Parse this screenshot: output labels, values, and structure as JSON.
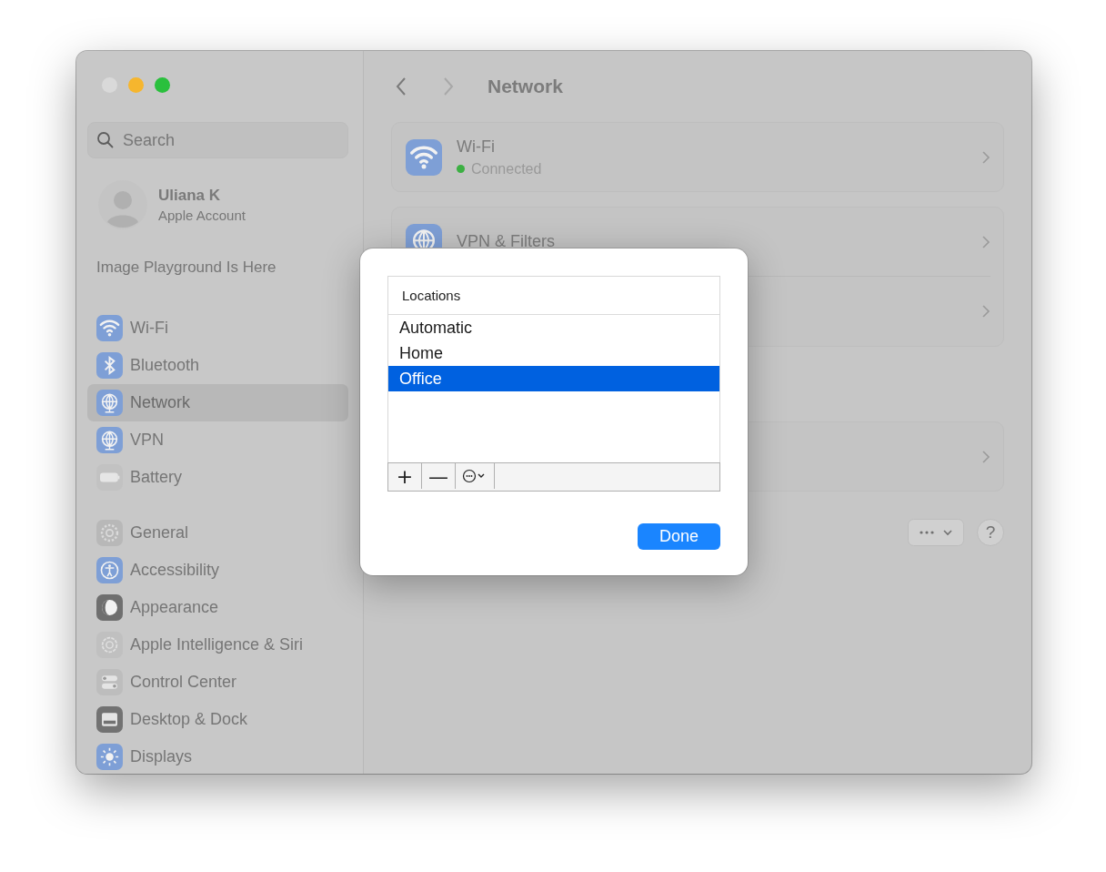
{
  "sidebar": {
    "search": {
      "placeholder": "Search"
    },
    "account": {
      "name": "Uliana K",
      "subtitle": "Apple Account"
    },
    "promo": "Image Playground Is Here",
    "groups": [
      [
        {
          "label": "Wi-Fi",
          "selected": false
        },
        {
          "label": "Bluetooth",
          "selected": false
        },
        {
          "label": "Network",
          "selected": true
        },
        {
          "label": "VPN",
          "selected": false
        },
        {
          "label": "Battery",
          "selected": false
        }
      ],
      [
        {
          "label": "General",
          "selected": false
        },
        {
          "label": "Accessibility",
          "selected": false
        },
        {
          "label": "Appearance",
          "selected": false
        },
        {
          "label": "Apple Intelligence & Siri",
          "selected": false
        },
        {
          "label": "Control Center",
          "selected": false
        },
        {
          "label": "Desktop & Dock",
          "selected": false
        },
        {
          "label": "Displays",
          "selected": false
        }
      ]
    ]
  },
  "main": {
    "title": "Network",
    "cards": [
      {
        "rows": [
          {
            "kind": "item",
            "title": "Wi-Fi",
            "status": "Connected"
          }
        ]
      },
      {
        "rows": [
          {
            "kind": "item",
            "title": "VPN & Filters"
          },
          {
            "kind": "blank"
          }
        ]
      },
      {
        "rows": [
          {
            "kind": "blank"
          }
        ]
      }
    ],
    "help": "?"
  },
  "dialog": {
    "header": "Locations",
    "rows": [
      {
        "label": "Automatic",
        "selected": false
      },
      {
        "label": "Home",
        "selected": false
      },
      {
        "label": "Office",
        "selected": true
      }
    ],
    "toolbar": [
      "+",
      "—"
    ],
    "done": "Done"
  }
}
